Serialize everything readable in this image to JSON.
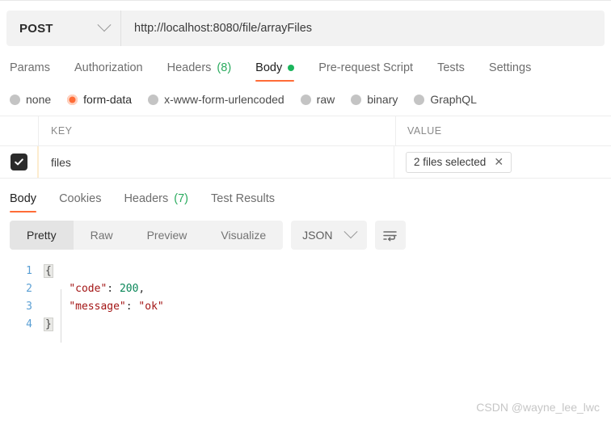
{
  "request": {
    "method": "POST",
    "url": "http://localhost:8080/file/arrayFiles",
    "tabs": [
      {
        "label": "Params",
        "active": false
      },
      {
        "label": "Authorization",
        "active": false
      },
      {
        "label": "Headers",
        "count": "(8)",
        "active": false
      },
      {
        "label": "Body",
        "active": true,
        "dot": true
      },
      {
        "label": "Pre-request Script",
        "active": false
      },
      {
        "label": "Tests",
        "active": false
      },
      {
        "label": "Settings",
        "active": false
      }
    ],
    "body_types": [
      {
        "label": "none",
        "selected": false
      },
      {
        "label": "form-data",
        "selected": true
      },
      {
        "label": "x-www-form-urlencoded",
        "selected": false
      },
      {
        "label": "raw",
        "selected": false
      },
      {
        "label": "binary",
        "selected": false
      },
      {
        "label": "GraphQL",
        "selected": false
      }
    ],
    "table": {
      "headers": {
        "key": "KEY",
        "value": "VALUE"
      },
      "rows": [
        {
          "checked": true,
          "key": "files",
          "value": "2 files selected"
        }
      ]
    }
  },
  "response": {
    "tabs": [
      {
        "label": "Body",
        "active": true
      },
      {
        "label": "Cookies",
        "active": false
      },
      {
        "label": "Headers",
        "count": "(7)",
        "active": false
      },
      {
        "label": "Test Results",
        "active": false
      }
    ],
    "view_modes": [
      {
        "label": "Pretty",
        "active": true
      },
      {
        "label": "Raw",
        "active": false
      },
      {
        "label": "Preview",
        "active": false
      },
      {
        "label": "Visualize",
        "active": false
      }
    ],
    "format": "JSON",
    "code_lines": [
      {
        "n": "1",
        "open_brace": "{"
      },
      {
        "n": "2",
        "key": "\"code\"",
        "colon": ": ",
        "num": "200",
        "comma": ","
      },
      {
        "n": "3",
        "key": "\"message\"",
        "colon": ": ",
        "str": "\"ok\""
      },
      {
        "n": "4",
        "close_brace": "}"
      }
    ]
  },
  "watermark": "CSDN @wayne_lee_lwc",
  "colors": {
    "accent": "#ff6c37",
    "green": "#1bb55c",
    "count_green": "#2aab5e",
    "json_key": "#a31515",
    "json_number": "#098658",
    "lineno": "#5a9fd4"
  }
}
